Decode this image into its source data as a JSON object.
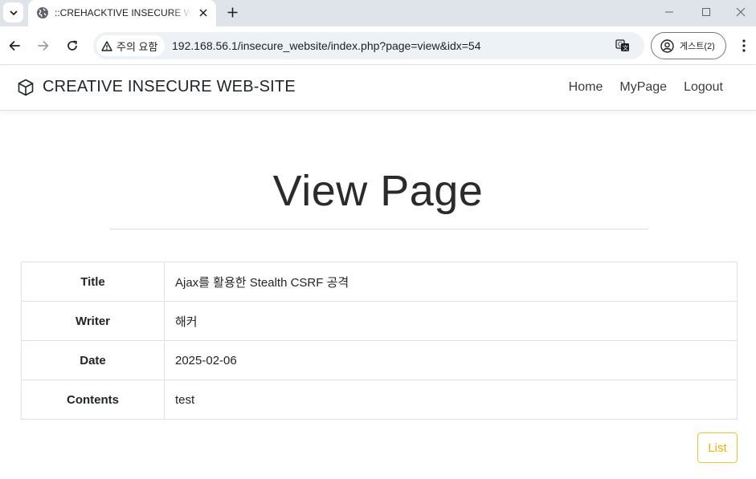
{
  "browser": {
    "tab_title": "::CREHACKTIVE INSECURE WEB-SITE::",
    "security_label": "주의 요함",
    "url": "192.168.56.1/insecure_website/index.php?page=view&idx=54",
    "profile_label": "게스트(2)"
  },
  "site": {
    "brand": "CREATIVE INSECURE WEB-SITE",
    "nav": [
      "Home",
      "MyPage",
      "Logout"
    ]
  },
  "page": {
    "heading": "View Page",
    "rows": [
      {
        "label": "Title",
        "value": "Ajax를 활용한 Stealth CSRF 공격"
      },
      {
        "label": "Writer",
        "value": "해커"
      },
      {
        "label": "Date",
        "value": "2025-02-06"
      },
      {
        "label": "Contents",
        "value": "test"
      }
    ],
    "list_button": "List"
  },
  "colors": {
    "tabbar_bg": "#dfe3ea",
    "omnibox_bg": "#eef1f6",
    "list_button_accent": "#f0b400"
  }
}
